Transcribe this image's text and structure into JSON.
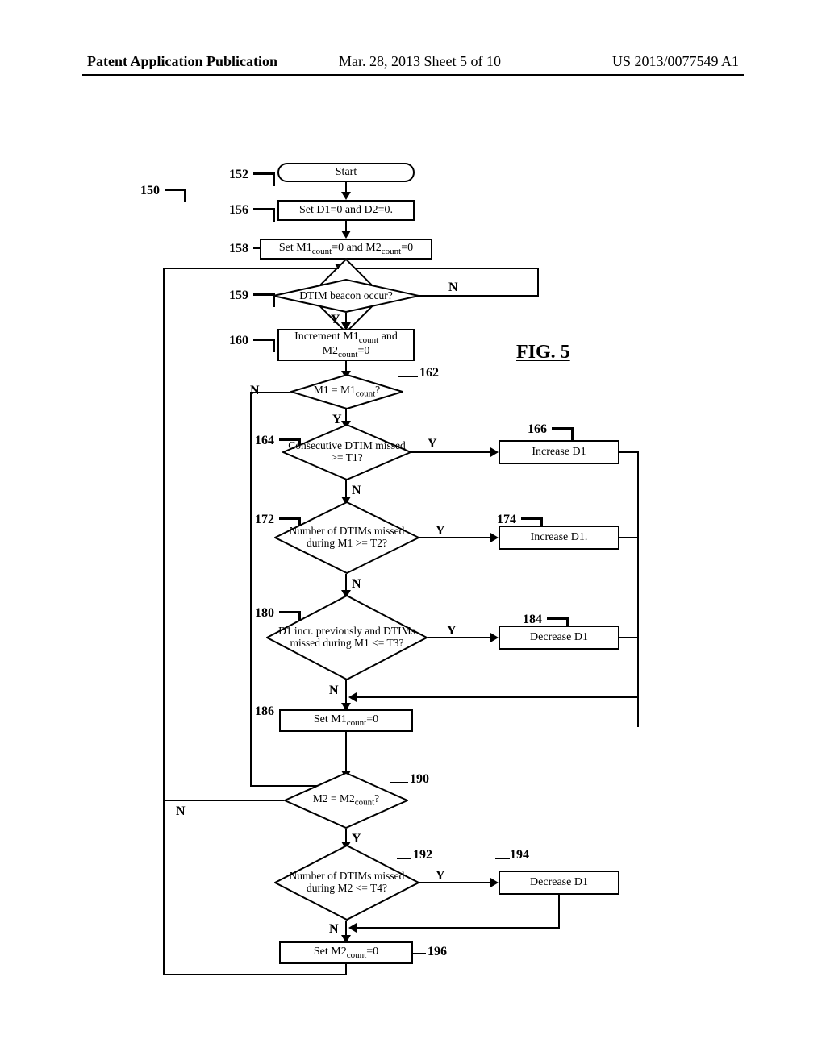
{
  "header": {
    "left": "Patent Application Publication",
    "center": "Mar. 28, 2013  Sheet 5 of 10",
    "right": "US 2013/0077549 A1"
  },
  "figure": {
    "title": "FIG. 5",
    "ref_main": "150",
    "nodes": {
      "n152": {
        "ref": "152",
        "text": "Start"
      },
      "n156": {
        "ref": "156",
        "text": "Set D1=0 and D2=0."
      },
      "n158": {
        "ref": "158",
        "text_html": "Set M1<sub>count</sub>=0 and M2<sub>count</sub>=0"
      },
      "n159": {
        "ref": "159",
        "text": "DTIM beacon occur?"
      },
      "n160": {
        "ref": "160",
        "text_html": "Increment M1<sub>count</sub> and M2<sub>count</sub>=0"
      },
      "n162": {
        "ref": "162",
        "text_html": "M1 = M1<sub>count</sub>?"
      },
      "n164": {
        "ref": "164",
        "text": "Consecutive DTIM missed >= T1?"
      },
      "n166": {
        "ref": "166",
        "text": "Increase D1"
      },
      "n172": {
        "ref": "172",
        "text": "Number of DTIMs missed during M1 >= T2?"
      },
      "n174": {
        "ref": "174",
        "text": "Increase D1."
      },
      "n180": {
        "ref": "180",
        "text": "D1 incr. previously and DTIMs missed during M1 <= T3?"
      },
      "n184": {
        "ref": "184",
        "text": "Decrease D1"
      },
      "n186": {
        "ref": "186",
        "text_html": "Set M1<sub>count</sub>=0"
      },
      "n190": {
        "ref": "190",
        "text_html": "M2 = M2<sub>count</sub>?"
      },
      "n192": {
        "ref": "192",
        "text": "Number of DTIMs missed during M2 <= T4?"
      },
      "n194": {
        "ref": "194",
        "text": "Decrease D1"
      },
      "n196": {
        "ref": "196",
        "text_html": "Set M2<sub>count</sub>=0"
      }
    },
    "edge_labels": {
      "yes": "Y",
      "no": "N"
    }
  }
}
